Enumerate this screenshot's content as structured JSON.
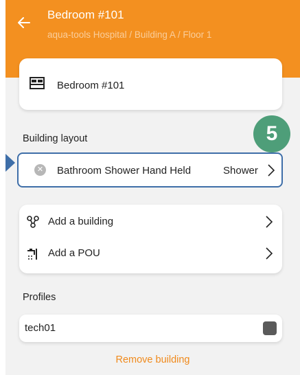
{
  "header": {
    "title": "Bedroom #101",
    "breadcrumb": "aqua-tools Hospital / Building A / Floor 1",
    "back_icon": "arrow-left-icon"
  },
  "room_card": {
    "icon": "bed-icon",
    "label": "Bedroom #101"
  },
  "building_layout": {
    "section_label": "Building layout",
    "items": [
      {
        "icon": "remove-circle-icon",
        "icon_glyph": "✕",
        "label": "Bathroom Shower Hand Held",
        "value": "Shower"
      }
    ]
  },
  "step_badge": {
    "number": "5",
    "color": "#4e9e79"
  },
  "actions": [
    {
      "icon": "nodes-icon",
      "label": "Add a building"
    },
    {
      "icon": "faucet-icon",
      "label": "Add a POU"
    }
  ],
  "profiles": {
    "section_label": "Profiles",
    "items": [
      {
        "name": "tech01",
        "checked": true
      }
    ]
  },
  "remove_link": "Remove building",
  "colors": {
    "brand": "#f39020",
    "highlight": "#3e6ea8",
    "link": "#f08a1c"
  }
}
